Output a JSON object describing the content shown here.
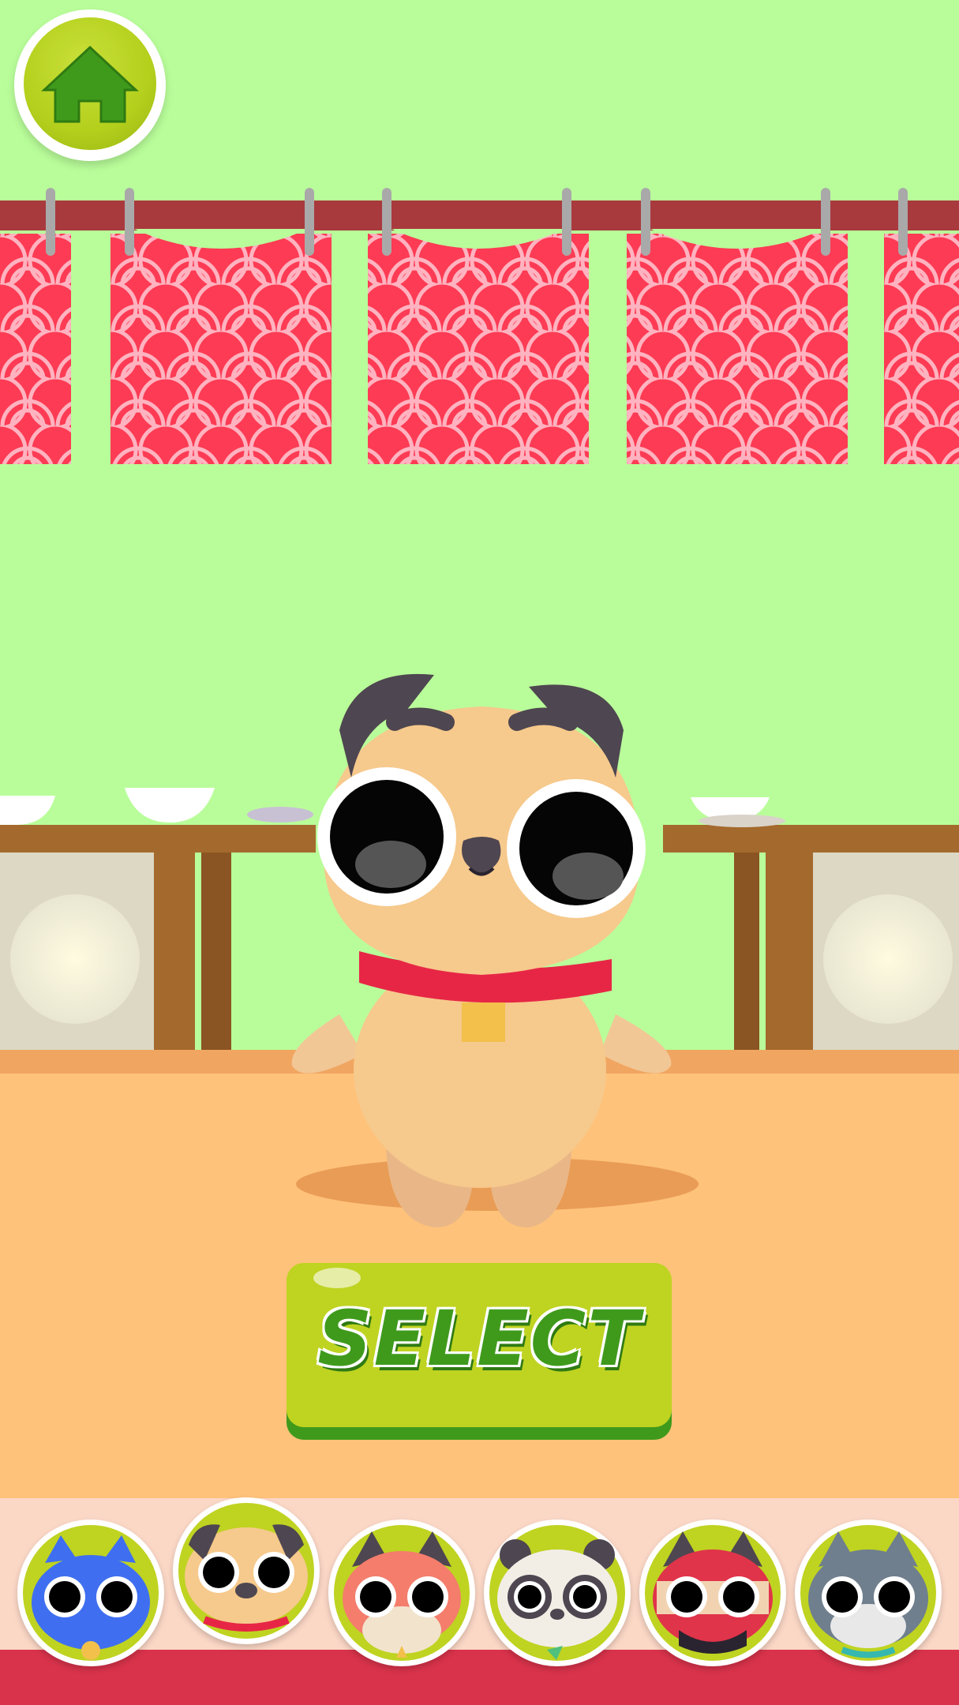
{
  "screen": "character-select",
  "home_button": {
    "icon": "home-icon"
  },
  "select_button": {
    "label": "SELECT"
  },
  "characters": [
    {
      "name": "blue-cat",
      "icon": "blue-cat-icon",
      "selected": false,
      "color": "#3f6ff0"
    },
    {
      "name": "pug",
      "icon": "pug-icon",
      "selected": true,
      "color": "#f6c98c"
    },
    {
      "name": "fox",
      "icon": "fox-icon",
      "selected": false,
      "color": "#f47d6c"
    },
    {
      "name": "panda",
      "icon": "panda-icon",
      "selected": false,
      "color": "#f2eee6"
    },
    {
      "name": "ninja-cat",
      "icon": "ninja-cat-icon",
      "selected": false,
      "color": "#e0344a"
    },
    {
      "name": "wolf",
      "icon": "wolf-icon",
      "selected": false,
      "color": "#6f7f8e"
    }
  ],
  "colors": {
    "background": "#b9fd9a",
    "curtain": "#fd3b54",
    "rail": "#a83a3e",
    "floor": "#ffc27a",
    "button_green": "#bfd321",
    "button_shadow": "#3f9a1c"
  }
}
